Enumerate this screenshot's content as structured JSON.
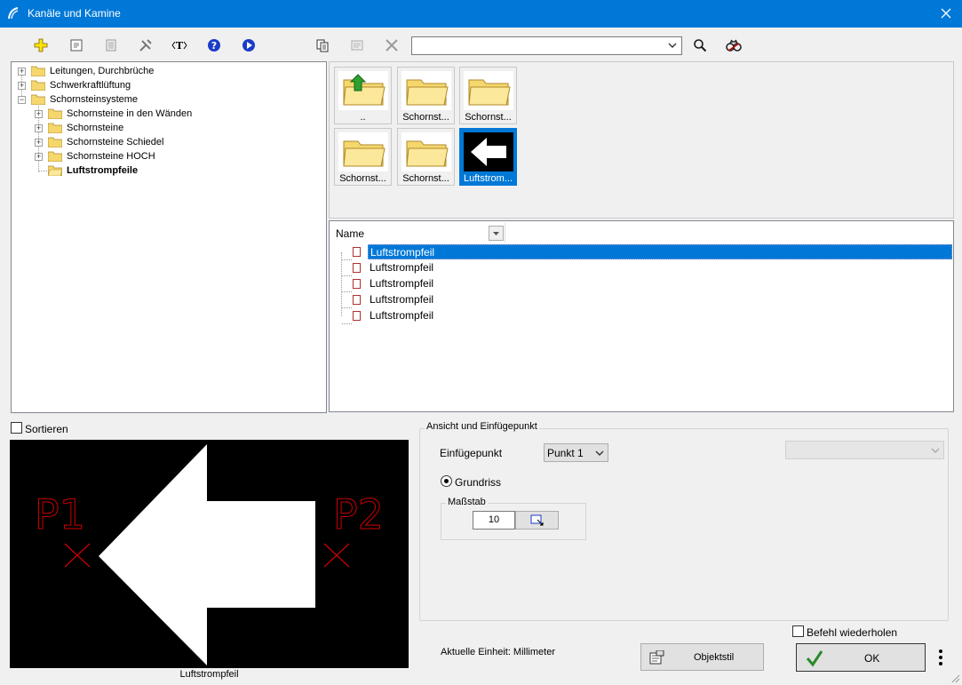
{
  "window": {
    "title": "Kanäle und Kamine"
  },
  "search": {
    "value": ""
  },
  "tree": {
    "items": [
      {
        "label": "Leitungen, Durchbrüche"
      },
      {
        "label": "Schwerkraftlüftung"
      },
      {
        "label": "Schornsteinsysteme"
      },
      {
        "label": "Schornsteine in den Wänden"
      },
      {
        "label": "Schornsteine"
      },
      {
        "label": "Schornsteine Schiedel"
      },
      {
        "label": "Schornsteine HOCH"
      },
      {
        "label": "Luftstrompfeile"
      }
    ]
  },
  "tiles": [
    {
      "label": ".."
    },
    {
      "label": "Schornst..."
    },
    {
      "label": "Schornst..."
    },
    {
      "label": "Schornst..."
    },
    {
      "label": "Schornst..."
    },
    {
      "label": "Luftstrom..."
    }
  ],
  "list": {
    "column_name": "Name",
    "rows": [
      {
        "label": "Luftstrompfeil"
      },
      {
        "label": "Luftstrompfeil"
      },
      {
        "label": "Luftstrompfeil"
      },
      {
        "label": "Luftstrompfeil"
      },
      {
        "label": "Luftstrompfeil"
      }
    ]
  },
  "sort": {
    "label": "Sortieren"
  },
  "preview": {
    "caption": "Luftstrompfeil",
    "p1": "P1",
    "p2": "P2"
  },
  "view_group": {
    "title": "Ansicht und Einfügepunkt",
    "insert_label": "Einfügepunkt",
    "insert_value": "Punkt 1",
    "ground_label": "Grundriss",
    "scale_title": "Maßstab",
    "scale_value": "10"
  },
  "footer": {
    "unit_text": "Aktuelle Einheit: Millimeter",
    "objectstyle_label": "Objektstil",
    "repeat_label": "Befehl wiederholen",
    "ok_label": "OK"
  },
  "colors": {
    "accent": "#0078d7",
    "preview_bg": "#000000",
    "preview_marker": "#cc0000"
  }
}
